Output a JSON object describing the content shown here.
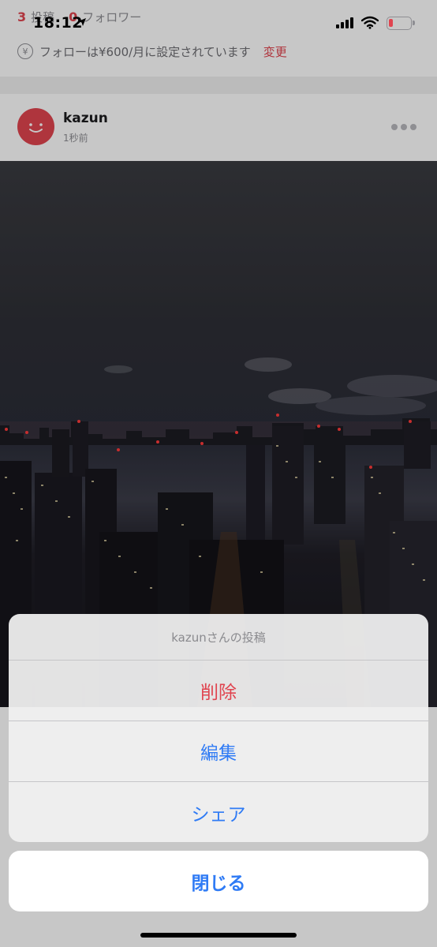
{
  "status_bar": {
    "time": "18:12"
  },
  "profile": {
    "posts_count": "3",
    "posts_label": "投稿",
    "followers_count": "0",
    "followers_label": "フォロワー",
    "price_text": "フォローは¥600/月に設定されています",
    "change_label": "変更",
    "yen_symbol": "¥"
  },
  "post": {
    "username": "kazun",
    "time_ago": "1秒前",
    "image_description": "night city skyline"
  },
  "action_sheet": {
    "title": "kazunさんの投稿",
    "delete_label": "削除",
    "edit_label": "編集",
    "share_label": "シェア",
    "close_label": "閉じる"
  },
  "colors": {
    "accent_red": "#e0444f",
    "ios_blue": "#2f7bf5"
  }
}
